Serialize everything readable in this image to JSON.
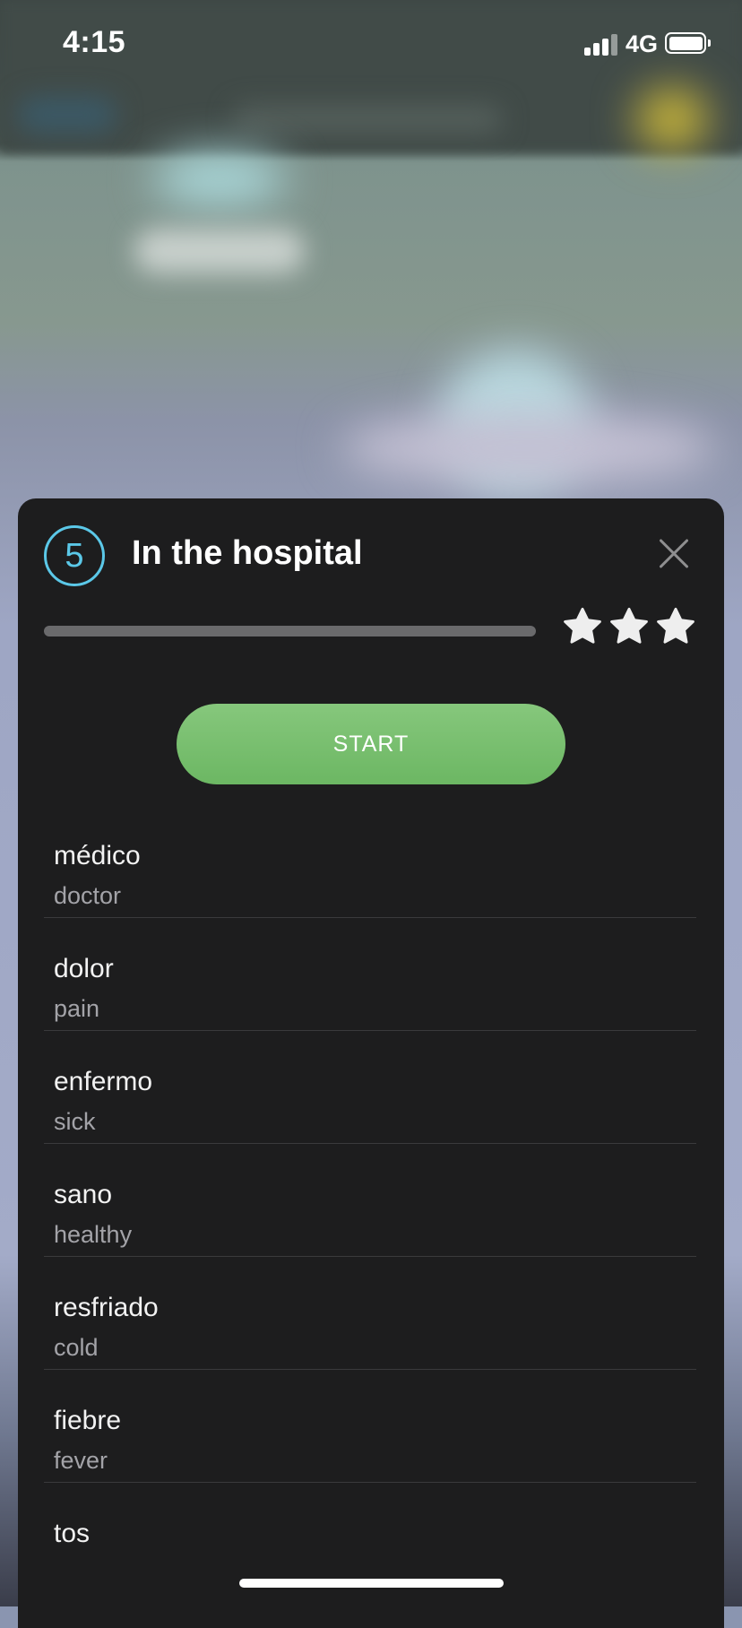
{
  "status_bar": {
    "time": "4:15",
    "network": "4G",
    "icons": [
      "signal-icon",
      "battery-icon"
    ]
  },
  "lesson": {
    "level": "5",
    "title": "In the hospital",
    "progress": 0,
    "stars_earned": 0,
    "stars_total": 3,
    "start_label": "START",
    "accent_color": "#5bc8e8",
    "button_color": "#73c06a",
    "close_icon": "close-icon"
  },
  "vocabulary": [
    {
      "word": "médico",
      "translation": "doctor"
    },
    {
      "word": "dolor",
      "translation": "pain"
    },
    {
      "word": "enfermo",
      "translation": "sick"
    },
    {
      "word": "sano",
      "translation": "healthy"
    },
    {
      "word": "resfriado",
      "translation": "cold"
    },
    {
      "word": "fiebre",
      "translation": "fever"
    },
    {
      "word": "tos",
      "translation": ""
    }
  ]
}
